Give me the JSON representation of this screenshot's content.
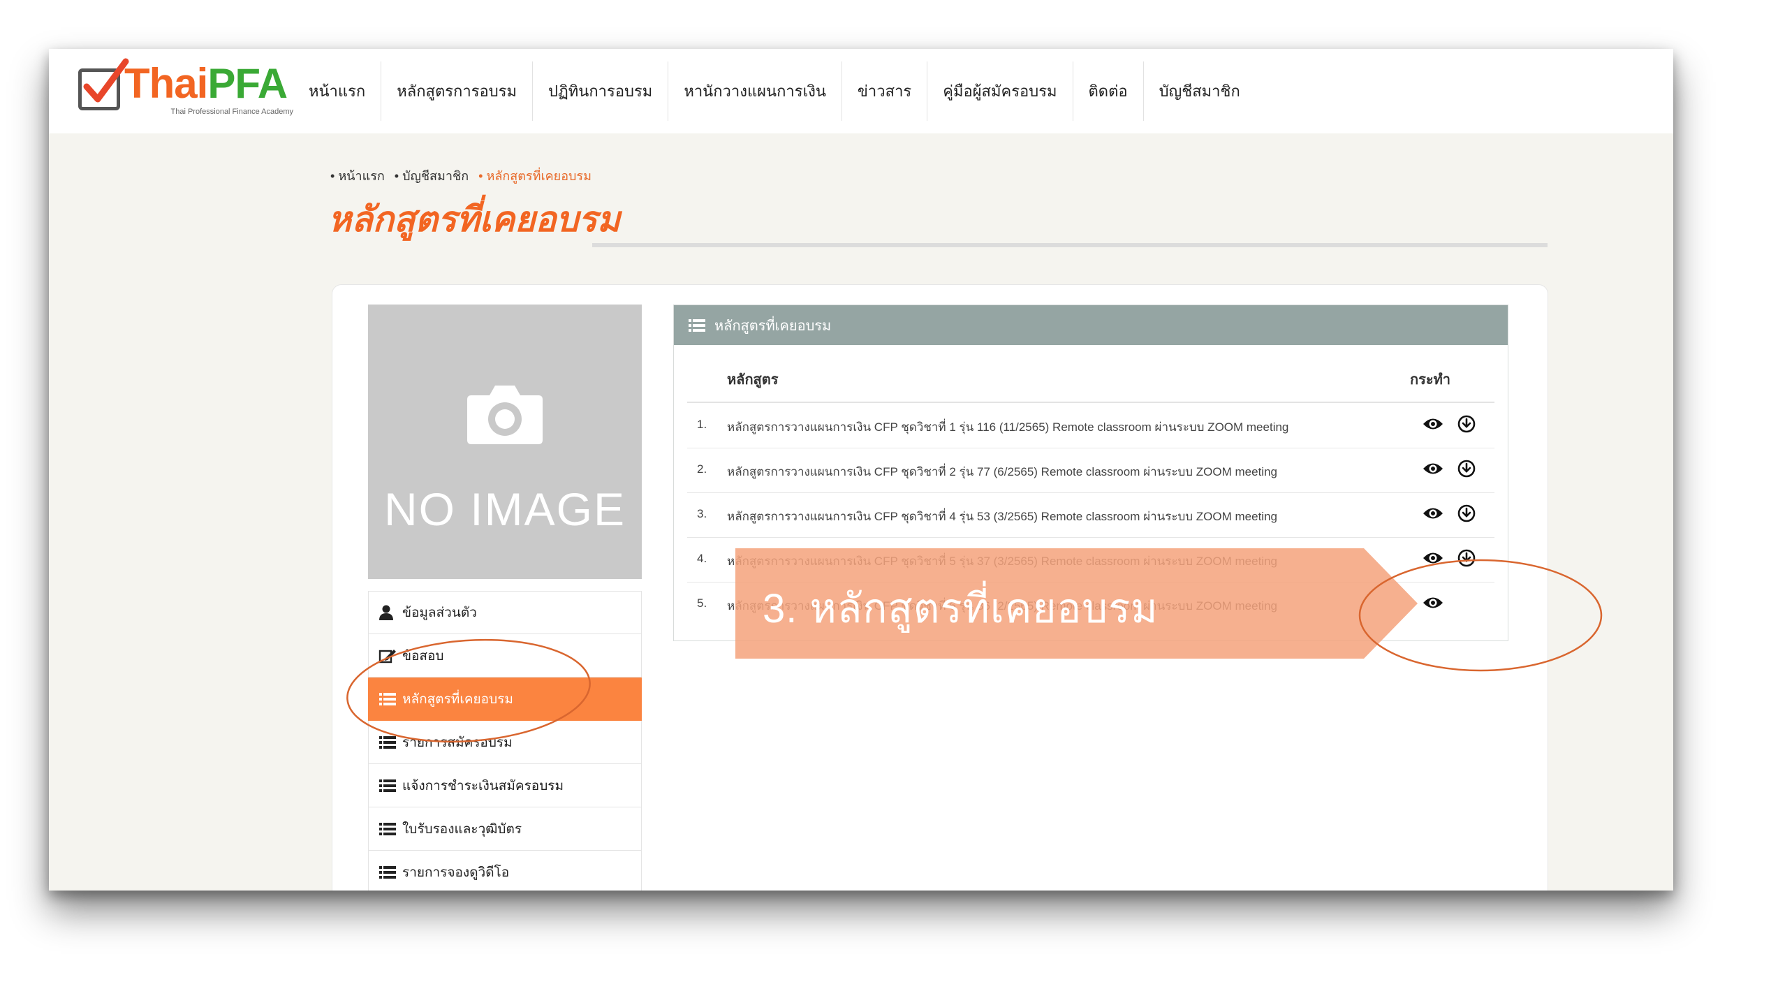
{
  "header": {
    "logo": {
      "brand_thai": "Thai",
      "brand_pfa": "PFA",
      "tagline": "Thai Professional Finance Academy"
    },
    "nav": [
      "หน้าแรก",
      "หลักสูตรการอบรม",
      "ปฏิทินการอบรม",
      "หานักวางแผนการเงิน",
      "ข่าวสาร",
      "คู่มือผู้สมัครอบรม",
      "ติดต่อ",
      "บัญชีสมาชิก"
    ]
  },
  "breadcrumb": [
    "หน้าแรก",
    "บัญชีสมาชิก",
    "หลักสูตรที่เคยอบรม"
  ],
  "page_title": "หลักสูตรที่เคยอบรม",
  "profile": {
    "no_image_text": "NO IMAGE"
  },
  "side_menu": [
    {
      "label": "ข้อมูลส่วนตัว",
      "icon": "user-icon"
    },
    {
      "label": "ข้อสอบ",
      "icon": "edit-icon"
    },
    {
      "label": "หลักสูตรที่เคยอบรม",
      "icon": "list-icon",
      "active": true
    },
    {
      "label": "รายการสมัครอบรม",
      "icon": "list-icon"
    },
    {
      "label": "แจ้งการชำระเงินสมัครอบรม",
      "icon": "list-icon"
    },
    {
      "label": "ใบรับรองและวุฒิบัตร",
      "icon": "list-icon"
    },
    {
      "label": "รายการจองดูวิดีโอ",
      "icon": "list-icon"
    }
  ],
  "panel": {
    "title": "หลักสูตรที่เคยอบรม",
    "columns": {
      "course": "หลักสูตร",
      "action": "กระทำ"
    },
    "rows": [
      {
        "num": "1.",
        "course": "หลักสูตรการวางแผนการเงิน CFP ชุดวิชาที่ 1 รุ่น 116 (11/2565) Remote classroom ผ่านระบบ ZOOM meeting",
        "download": true
      },
      {
        "num": "2.",
        "course": "หลักสูตรการวางแผนการเงิน CFP ชุดวิชาที่ 2 รุ่น 77 (6/2565) Remote classroom ผ่านระบบ ZOOM meeting",
        "download": true
      },
      {
        "num": "3.",
        "course": "หลักสูตรการวางแผนการเงิน CFP ชุดวิชาที่ 4 รุ่น 53 (3/2565) Remote classroom ผ่านระบบ ZOOM meeting",
        "download": true
      },
      {
        "num": "4.",
        "course": "หลักสูตรการวางแผนการเงิน CFP ชุดวิชาที่ 5 รุ่น 37 (3/2565) Remote classroom ผ่านระบบ ZOOM meeting",
        "download": true
      },
      {
        "num": "5.",
        "course": "หลักสูตรการวางแผนการเงิน CFP ชุดวิชาที่ 6 รุ่น 36 (2/2565) Remote classroom ผ่านระบบ ZOOM meeting",
        "download": false
      }
    ]
  },
  "annotation": {
    "step_text": "3.    หลักสูตรที่เคยอบรม"
  },
  "colors": {
    "accent_orange": "#f26522",
    "menu_active": "#fb8440",
    "panel_header": "#95a5a3",
    "annotation_arrow": "#f4a27b",
    "annotation_ellipse": "#d9662f"
  }
}
